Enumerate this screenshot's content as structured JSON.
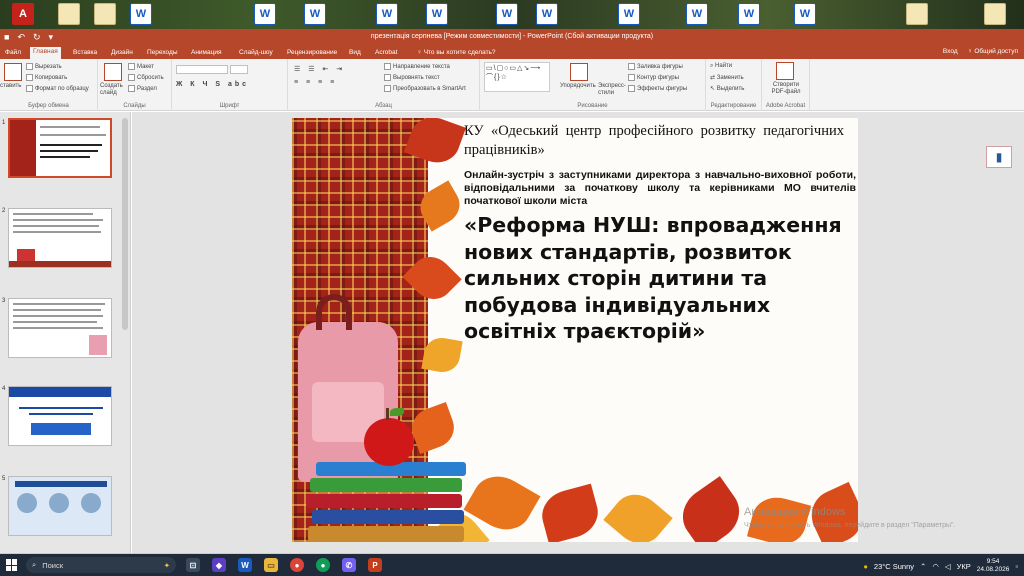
{
  "window": {
    "title": "презентація серпнева [Режим совместимости] - PowerPoint (Сбой активации продукта)"
  },
  "tabs": [
    "Файл",
    "Главная",
    "Вставка",
    "Дизайн",
    "Переходы",
    "Анимация",
    "Слайд-шоу",
    "Рецензирование",
    "Вид",
    "Acrobat"
  ],
  "active_tab": "Главная",
  "tell_me": "Что вы хотите сделать?",
  "account": {
    "signin": "Вход",
    "share": "Общий доступ"
  },
  "ribbon": {
    "clipboard": {
      "paste": "ставить",
      "cut": "Вырезать",
      "copy": "Копировать",
      "format": "Формат по образцу",
      "label": "Буфер обмена"
    },
    "slides": {
      "new_slide": "Создать слайд",
      "layout": "Макет",
      "reset": "Сбросить",
      "section": "Раздел",
      "label": "Слайды"
    },
    "font": {
      "label": "Шрифт"
    },
    "paragraph": {
      "direction": "Направление текста",
      "align": "Выровнять текст",
      "smartart": "Преобразовать в SmartArt",
      "label": "Абзац"
    },
    "drawing": {
      "arrange": "Упорядочить",
      "styles": "Экспресс-стили",
      "fill": "Заливка фигуры",
      "outline": "Контур фигуры",
      "effects": "Эффекты фигуры",
      "label": "Рисование"
    },
    "editing": {
      "find": "Найти",
      "replace": "Заменить",
      "select": "Выделить",
      "label": "Редактирование"
    },
    "acrobat": {
      "create_pdf": "Створити PDF-файл",
      "label": "Adobe Acrobat"
    }
  },
  "thumbnails": [
    "1",
    "2",
    "3",
    "4",
    "5"
  ],
  "slide": {
    "org": "КУ «Одеський центр професійного розвитку педагогічних працівників»",
    "meeting": "Онлайн-зустріч з заступниками директора з навчально-виховної роботи, відповідальними за початкову школу та керівниками МО вчителів початкової школи міста",
    "title": "«Реформа НУШ: впровадження нових стандартів, розвиток сильних сторін дитини та побудова індивідуальних освітніх траєкторій»"
  },
  "watermark": {
    "line1": "Активация Windows",
    "line2": "Чтобы активировать Windows, перейдите в раздел \"Параметры\"."
  },
  "taskbar": {
    "search": "Поиск",
    "weather": "23°C Sunny",
    "lang": "УКР",
    "time": "9:54",
    "date": "24.08.2026"
  }
}
